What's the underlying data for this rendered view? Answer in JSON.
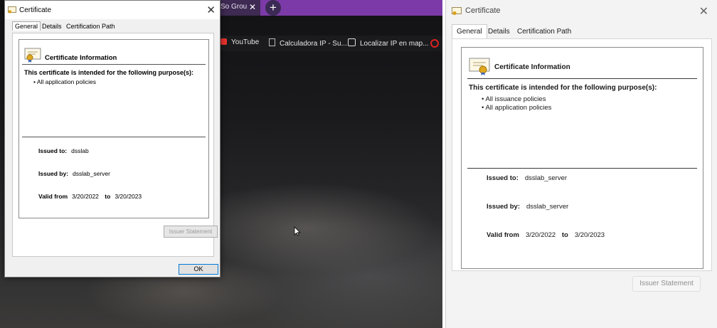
{
  "browser": {
    "tab_title": "So Grou",
    "tab_close": "✕",
    "new_tab": "+",
    "bookmarks": [
      "YouTube",
      "Calculadora IP - Su...",
      "Localizar IP en map..."
    ]
  },
  "dialog_left": {
    "title": "Certificate",
    "close": "✕",
    "tabs": [
      "General",
      "Details",
      "Certification Path"
    ],
    "heading": "Certificate Information",
    "purpose_text": "This certificate is intended for the following purpose(s):",
    "policies": [
      "• All application policies"
    ],
    "issued_to_label": "Issued to:",
    "issued_to": "dsslab",
    "issued_by_label": "Issued by:",
    "issued_by": "dsslab_server",
    "valid_from_label": "Valid from",
    "valid_from": "3/20/2022",
    "to_label": "to",
    "valid_to": "3/20/2023",
    "issuer_statement": "Issuer Statement",
    "ok": "OK"
  },
  "dialog_right": {
    "title": "Certificate",
    "close": "✕",
    "tabs": [
      "General",
      "Details",
      "Certification Path"
    ],
    "heading": "Certificate Information",
    "purpose_text": "This certificate is intended for the following purpose(s):",
    "policies": [
      "• All issuance policies",
      "• All application policies"
    ],
    "issued_to_label": "Issued to:",
    "issued_to": "dsslab_server",
    "issued_by_label": "Issued by:",
    "issued_by": "dsslab_server",
    "valid_from_label": "Valid from",
    "valid_from": "3/20/2022",
    "to_label": "to",
    "valid_to": "3/20/2023",
    "issuer_statement": "Issuer Statement"
  },
  "colors": {
    "browser_tabstrip": "#7c3aa8",
    "focus_border": "#0078d7"
  }
}
